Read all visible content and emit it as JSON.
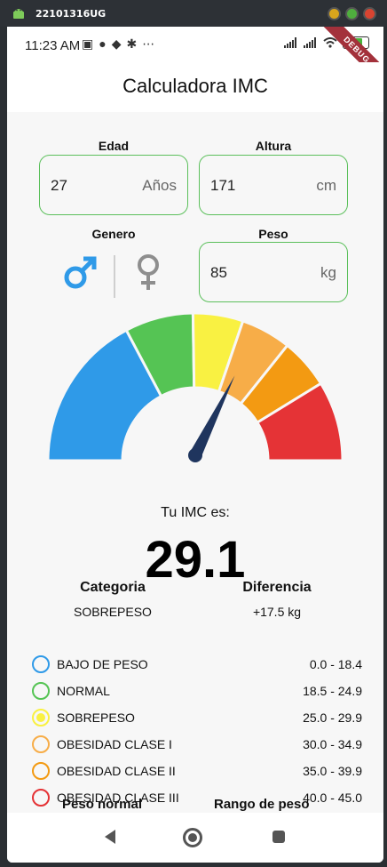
{
  "window": {
    "title": "22101316UG"
  },
  "status": {
    "time": "11:23 AM",
    "battery": "75",
    "debug_banner": "DEBUG"
  },
  "app": {
    "title": "Calculadora IMC"
  },
  "inputs": {
    "edad": {
      "label": "Edad",
      "value": "27",
      "unit": "Años"
    },
    "altura": {
      "label": "Altura",
      "value": "171",
      "unit": "cm"
    },
    "genero": {
      "label": "Genero",
      "male_symbol": "♂",
      "female_symbol": "♀",
      "selected": "male"
    },
    "peso": {
      "label": "Peso",
      "value": "85",
      "unit": "kg"
    }
  },
  "gauge": {
    "value": 29.1,
    "min": 0,
    "max": 45,
    "colors": [
      "#2f9ae8",
      "#55c454",
      "#f9f142",
      "#f7ad48",
      "#f39a12",
      "#e53336"
    ]
  },
  "result": {
    "label": "Tu IMC es:",
    "value": "29.1",
    "categoria_label": "Categoria",
    "categoria_value": "SOBREPESO",
    "diferencia_label": "Diferencia",
    "diferencia_value": "+17.5 kg"
  },
  "categories": [
    {
      "name": "BAJO DE PESO",
      "range": "0.0 - 18.4",
      "color": "#2f9ae8",
      "selected": false
    },
    {
      "name": "NORMAL",
      "range": "18.5 - 24.9",
      "color": "#55c454",
      "selected": false
    },
    {
      "name": "SOBREPESO",
      "range": "25.0 - 29.9",
      "color": "#f9f142",
      "selected": true
    },
    {
      "name": "OBESIDAD CLASE I",
      "range": "30.0 - 34.9",
      "color": "#f7ad48",
      "selected": false
    },
    {
      "name": "OBESIDAD CLASE II",
      "range": "35.0 - 39.9",
      "color": "#f39a12",
      "selected": false
    },
    {
      "name": "OBESIDAD CLASE III",
      "range": "40.0 - 45.0",
      "color": "#e53336",
      "selected": false
    }
  ],
  "peek": {
    "left": "Peso normal",
    "right": "Rango de peso"
  }
}
